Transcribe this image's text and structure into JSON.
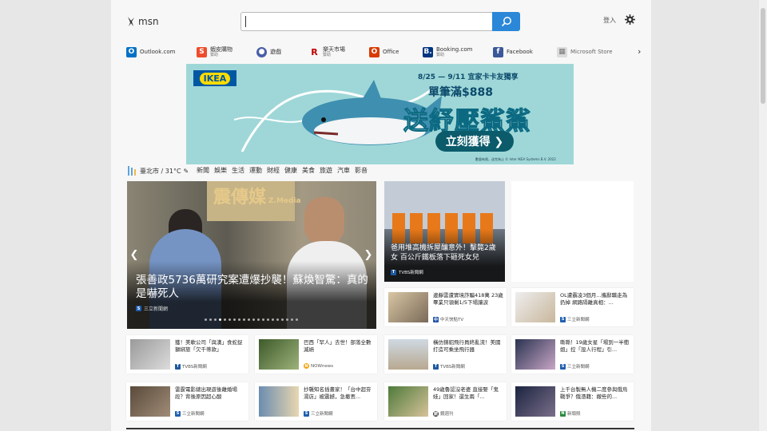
{
  "header": {
    "logo_text": "msn",
    "search": {
      "value": "",
      "placeholder": ""
    },
    "signin_label": "登入"
  },
  "shortcuts": [
    {
      "label": "Outlook.com",
      "sub": "",
      "icon": "outlook-icon",
      "color": "#0072c6",
      "glyph": "O"
    },
    {
      "label": "蝦皮購物",
      "sub": "贊助",
      "icon": "shopee-icon",
      "color": "#ee4d2d",
      "glyph": "S"
    },
    {
      "label": "遊戲",
      "sub": "",
      "icon": "games-icon",
      "color": "#4a5fa8",
      "glyph": "●"
    },
    {
      "label": "樂天市場",
      "sub": "贊助",
      "icon": "rakuten-icon",
      "color": "#bf0000",
      "glyph": "R"
    },
    {
      "label": "Office",
      "sub": "",
      "icon": "office-icon",
      "color": "#d83b01",
      "glyph": "O"
    },
    {
      "label": "Booking.com",
      "sub": "贊助",
      "icon": "booking-icon",
      "color": "#003580",
      "glyph": "B."
    },
    {
      "label": "Facebook",
      "sub": "",
      "icon": "facebook-icon",
      "color": "#3b5998",
      "glyph": "f"
    },
    {
      "label": "Microsoft Store",
      "sub": "",
      "icon": "microsoft-store-icon",
      "color": "#dcdcdc",
      "glyph": "▦"
    }
  ],
  "ad": {
    "brand": "IKEA",
    "date": "8/25 — 9/11 宜家卡卡友獨享",
    "line1": "單筆滿$888",
    "line2": "送紓壓鯊鯊",
    "cta": "立刻獲得 ❯",
    "fine": "數量有限，送完為止  © Inter IKEA Systems B.V. 2022"
  },
  "weather": {
    "text": "臺北市 / 31°C"
  },
  "nav": [
    "新聞",
    "娛樂",
    "生活",
    "運動",
    "財經",
    "健康",
    "美食",
    "旅遊",
    "汽車",
    "影音"
  ],
  "hero": {
    "brand": "震傳媒",
    "brand_small": "Z.Media",
    "title": "張善政5736萬研究案遭爆抄襲！蘇煥智驚：真的是嚇死人",
    "source": "三立新聞網"
  },
  "card2": {
    "title": "爸用堆高機拆屋釀意外！擊斃2歲女 百公斤鐵板落下砸死女兒",
    "source": "TVBS新聞網"
  },
  "cards": [
    {
      "title": "邊靜雲遭實境詐騙418萬 23歲畢業只領剩1/5下場讓淚",
      "source": "中天快點TV",
      "src_color": "#1e4fa8"
    },
    {
      "title": "OL遭霸凌3個月...攜辭職走為扔掉 網路隔離真相：...",
      "source": "三立新聞網",
      "src_color": "#1f5fb0"
    },
    {
      "title": "獲！美軟公司「與漢」食蛇捉獅綁旅「欠千蒂款」",
      "source": "TVBS新聞網",
      "src_color": "#1e5aa0"
    },
    {
      "title": "巴西「罕人」去世！部落全數滅絕",
      "source": "NOWnews",
      "src_color": "#f2a20d"
    },
    {
      "title": "橫仿錦貂飛行員終亂流！美國打造可乘坐飛行器",
      "source": "TVBS新聞網",
      "src_color": "#1e5aa0"
    },
    {
      "title": "嘶嘶！19歲女星「場到一半衝姐」控「設人行程」引...",
      "source": "三立新聞網",
      "src_color": "#1f5fb0"
    },
    {
      "title": "雷霆電影總出現遊後離婚場段？背後原因超心酸",
      "source": "三立新聞網",
      "src_color": "#1f5fb0"
    },
    {
      "title": "抄襲知名插畫家！「台中超夯湯店」被震撼，急撤丟...",
      "source": "三立新聞網",
      "src_color": "#1f5fb0"
    },
    {
      "title": "49歲魯認沒老婆 直接娶「鬼娃」回家！還生兩「...",
      "source": "鏡週刊",
      "src_color": "#333333"
    },
    {
      "title": "上千台製無人機二度參與俄烏戰爭？俄憑藉：撤些的...",
      "source": "新頭殼",
      "src_color": "#2b8a3e"
    }
  ]
}
